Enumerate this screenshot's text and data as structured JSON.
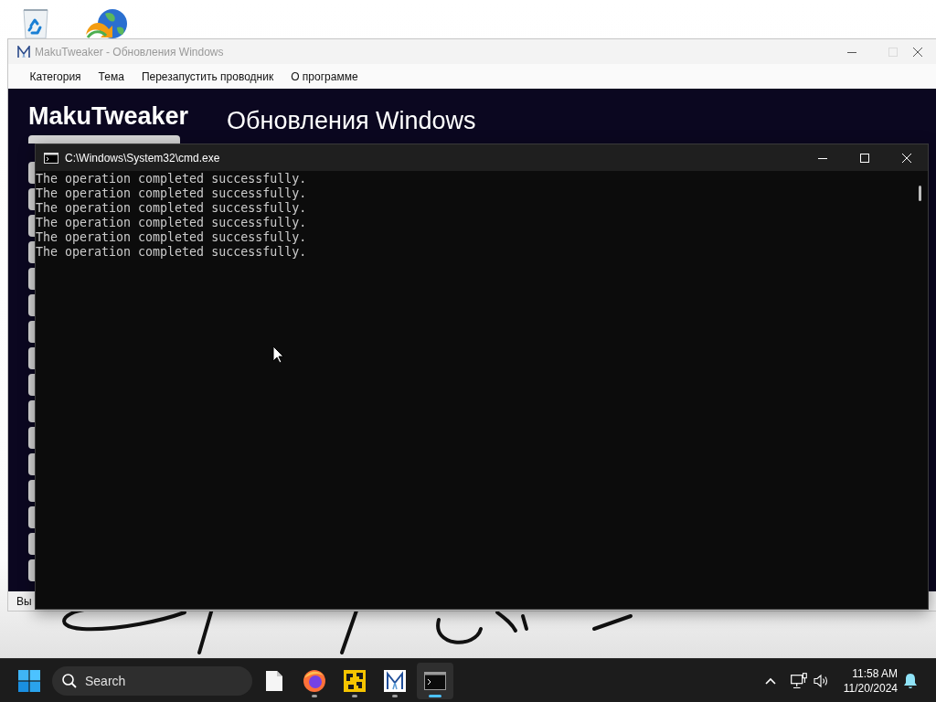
{
  "desktop": {
    "shortcuts": [
      {
        "kind": "recycle-bin"
      },
      {
        "kind": "globe"
      }
    ]
  },
  "app_window": {
    "title": "MakuTweaker - Обновления Windows",
    "controls": [
      {
        "kind": "minimize",
        "disabled": false
      },
      {
        "kind": "maximize",
        "disabled": true
      },
      {
        "kind": "close",
        "disabled": false
      }
    ],
    "menu": [
      "Категория",
      "Тема",
      "Перезапустить проводник",
      "О программе"
    ],
    "logo": "MakuTweaker",
    "heading": "Обновления Windows",
    "status_bar": "Вы"
  },
  "console_window": {
    "title": "C:\\Windows\\System32\\cmd.exe",
    "controls": [
      {
        "kind": "minimize",
        "disabled": false
      },
      {
        "kind": "maximize",
        "disabled": false
      },
      {
        "kind": "close",
        "disabled": false
      }
    ],
    "lines": [
      "The operation completed successfully.",
      "The operation completed successfully.",
      "The operation completed successfully.",
      "The operation completed successfully.",
      "The operation completed successfully.",
      "The operation completed successfully."
    ]
  },
  "taskbar": {
    "search": {
      "placeholder": "Search"
    },
    "apps": [
      {
        "kind": "document",
        "running": false,
        "selected": false
      },
      {
        "kind": "browser",
        "running": true,
        "selected": false
      },
      {
        "kind": "tool",
        "running": true,
        "selected": false
      },
      {
        "kind": "tweaker",
        "running": true,
        "selected": false
      },
      {
        "kind": "terminal",
        "running": true,
        "selected": true
      }
    ],
    "clock": {
      "time": "11:58 AM",
      "date": "11/20/2024"
    }
  }
}
